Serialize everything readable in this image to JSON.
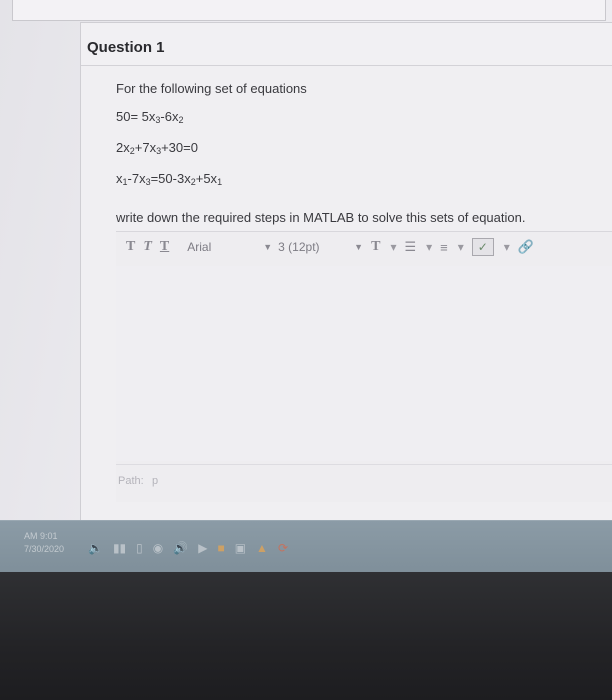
{
  "question": {
    "title": "Question 1",
    "intro": "For the following set of equations",
    "equations": [
      {
        "parts": [
          "50= 5x",
          "3",
          "-6x",
          "2",
          "",
          ""
        ]
      },
      {
        "parts": [
          "2x",
          "2",
          "+7x",
          "3",
          "+30=0",
          ""
        ]
      },
      {
        "parts": [
          "x",
          "1",
          "-7x",
          "3",
          "=50-3x",
          "2"
        ]
      }
    ],
    "eq3_tail": [
      "+5x",
      "1"
    ],
    "prompt": "write down the required steps in MATLAB to solve this sets of equation."
  },
  "editor": {
    "toolbar": {
      "bold": "T",
      "italic": "T",
      "underline": "T",
      "font": "Arial",
      "size": "3 (12pt)",
      "text_color": "T"
    },
    "path_label": "Path:",
    "path_value": "p"
  },
  "taskbar": {
    "time": "AM 9:01",
    "date": "7/30/2020"
  }
}
